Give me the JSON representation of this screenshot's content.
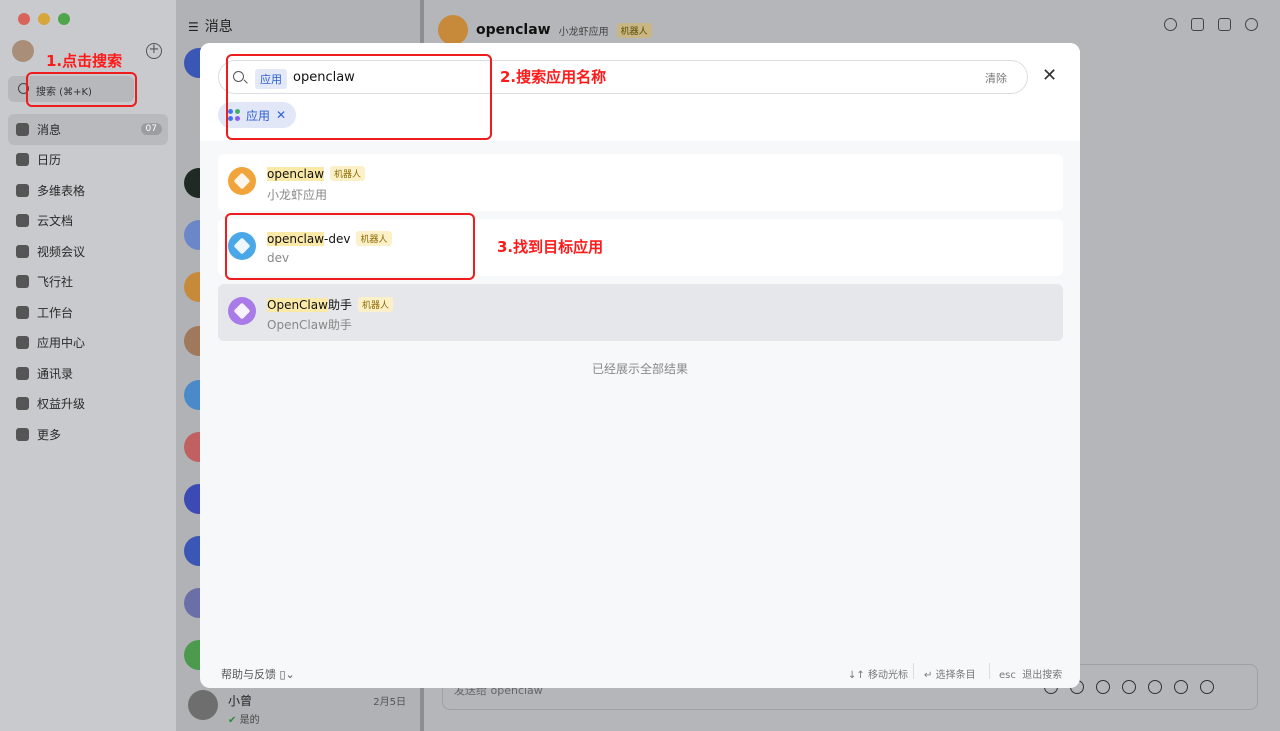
{
  "sidebar": {
    "search_label": "搜索 (⌘+K)",
    "nav": [
      {
        "label": "消息",
        "icon": "chat-bubble-icon",
        "badge": "07",
        "active": true
      },
      {
        "label": "日历",
        "icon": "calendar-icon"
      },
      {
        "label": "多维表格",
        "icon": "table-icon"
      },
      {
        "label": "云文档",
        "icon": "document-icon"
      },
      {
        "label": "视频会议",
        "icon": "video-icon"
      },
      {
        "label": "飞行社",
        "icon": "community-icon"
      },
      {
        "label": "工作台",
        "icon": "workspace-icon"
      },
      {
        "label": "应用中心",
        "icon": "app-center-icon"
      },
      {
        "label": "通讯录",
        "icon": "contacts-icon"
      },
      {
        "label": "权益升级",
        "icon": "diamond-icon"
      },
      {
        "label": "更多",
        "icon": "more-icon"
      }
    ]
  },
  "conversation_list": {
    "title": "消息",
    "bottom_item": {
      "name": "小曾",
      "date": "2月5日",
      "preview": "是的"
    }
  },
  "chat": {
    "title": "openclaw",
    "subtitle": "小龙虾应用",
    "tag": "机器人",
    "input_placeholder": "发送给 openclaw"
  },
  "search_modal": {
    "scope_chip": "应用",
    "query": "openclaw",
    "clear_label": "清除",
    "filter_chip": "应用",
    "results": [
      {
        "highlight": "openclaw",
        "rest": "",
        "tag": "机器人",
        "sub": "小龙虾应用",
        "color": "#f0a43a"
      },
      {
        "highlight": "openclaw",
        "rest": "-dev",
        "tag": "机器人",
        "sub": "dev",
        "color": "#4aa8e8"
      },
      {
        "highlight": "OpenClaw",
        "rest": "助手",
        "tag": "机器人",
        "sub": "OpenClaw助手",
        "color": "#a97be8",
        "selected": true
      }
    ],
    "end_text": "已经展示全部结果",
    "footer": {
      "help": "帮助与反馈",
      "move_key": "↓↑",
      "move_label": "移动光标",
      "select_key": "↵",
      "select_label": "选择条目",
      "esc_key": "esc",
      "esc_label": "退出搜索"
    }
  },
  "annotations": {
    "step1": "1.点击搜索",
    "step2": "2.搜索应用名称",
    "step3": "3.找到目标应用"
  },
  "colors": {
    "accent": "#2d5fd3",
    "annotation": "#ee1c1c"
  }
}
